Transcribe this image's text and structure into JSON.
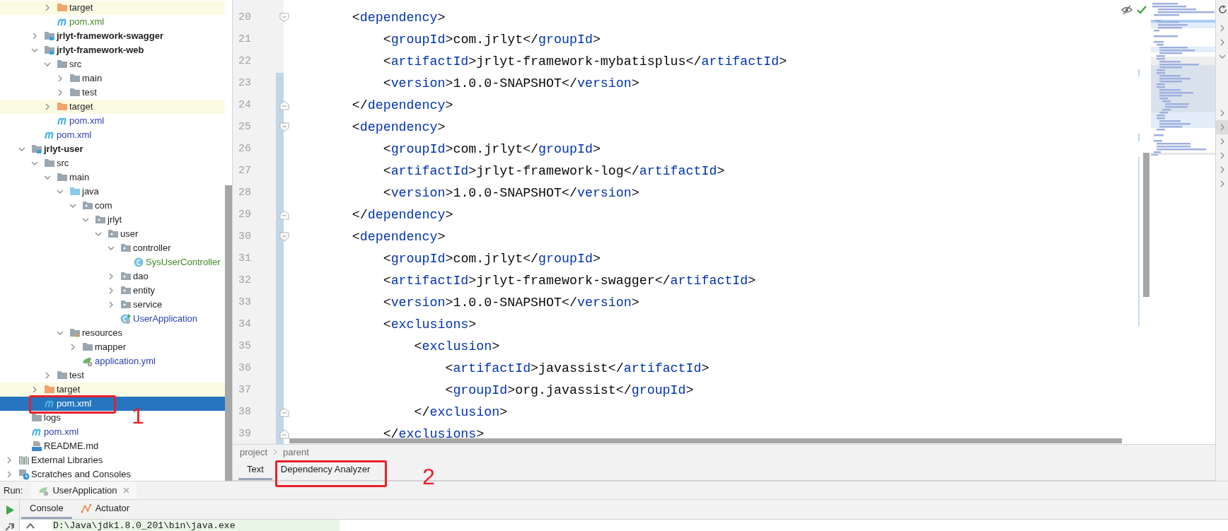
{
  "project_tree": {
    "items": [
      {
        "children": [
          {
            "children": [
              {
                "children": [
                  {
                    "label": "target",
                    "kind": "excluded-folder",
                    "expanded": false,
                    "selected": false
                  },
                  {
                    "label": "pom.xml",
                    "kind": "maven",
                    "color": "#3f8a24",
                    "selected": false
                  }
                ]
              },
              {
                "label": "jrlyt-framework-swagger",
                "kind": "module",
                "expanded": false,
                "selected": false
              },
              {
                "label": "jrlyt-framework-web",
                "kind": "module",
                "expanded": true,
                "selected": false,
                "children": [
                  {
                    "label": "src",
                    "kind": "folder",
                    "expanded": true,
                    "selected": false,
                    "children": [
                      {
                        "label": "main",
                        "kind": "folder",
                        "expanded": false,
                        "selected": false
                      },
                      {
                        "label": "test",
                        "kind": "folder",
                        "expanded": false,
                        "selected": false
                      }
                    ]
                  },
                  {
                    "label": "target",
                    "kind": "excluded-folder",
                    "expanded": false,
                    "selected": false
                  },
                  {
                    "label": "pom.xml",
                    "kind": "maven",
                    "color": "#2a3eb0",
                    "selected": false
                  }
                ]
              },
              {
                "label": "pom.xml",
                "kind": "maven",
                "color": "#2a3eb0",
                "selected": false
              }
            ]
          },
          {
            "label": "jrlyt-user",
            "kind": "module",
            "expanded": true,
            "selected": false,
            "children": [
              {
                "label": "src",
                "kind": "folder",
                "expanded": true,
                "selected": false,
                "children": [
                  {
                    "label": "main",
                    "kind": "folder",
                    "expanded": true,
                    "selected": false,
                    "children": [
                      {
                        "label": "java",
                        "kind": "source-folder",
                        "expanded": true,
                        "selected": false,
                        "children": [
                          {
                            "label": "com",
                            "kind": "package",
                            "expanded": true,
                            "selected": false,
                            "children": [
                              {
                                "label": "jrlyt",
                                "kind": "package",
                                "expanded": true,
                                "selected": false,
                                "children": [
                                  {
                                    "label": "user",
                                    "kind": "package",
                                    "expanded": true,
                                    "selected": false,
                                    "children": [
                                      {
                                        "label": "controller",
                                        "kind": "package",
                                        "expanded": true,
                                        "selected": false,
                                        "children": [
                                          {
                                            "label": "SysUserController",
                                            "kind": "class",
                                            "color": "#3f8a24",
                                            "selected": false
                                          }
                                        ]
                                      },
                                      {
                                        "label": "dao",
                                        "kind": "package",
                                        "expanded": false,
                                        "selected": false
                                      },
                                      {
                                        "label": "entity",
                                        "kind": "package",
                                        "expanded": false,
                                        "selected": false
                                      },
                                      {
                                        "label": "service",
                                        "kind": "package",
                                        "expanded": false,
                                        "selected": false
                                      },
                                      {
                                        "label": "UserApplication",
                                        "kind": "app-class",
                                        "color": "#2a3eb0",
                                        "selected": false
                                      }
                                    ]
                                  }
                                ]
                              }
                            ]
                          }
                        ]
                      },
                      {
                        "label": "resources",
                        "kind": "resources-folder",
                        "expanded": true,
                        "selected": false,
                        "children": [
                          {
                            "label": "mapper",
                            "kind": "folder",
                            "expanded": false,
                            "selected": false
                          },
                          {
                            "label": "application.yml",
                            "kind": "yaml",
                            "color": "#2a3eb0",
                            "selected": false
                          }
                        ]
                      }
                    ]
                  },
                  {
                    "label": "test",
                    "kind": "folder",
                    "expanded": false,
                    "selected": false
                  }
                ]
              },
              {
                "label": "target",
                "kind": "excluded-folder",
                "expanded": false,
                "selected": false
              },
              {
                "label": "pom.xml",
                "kind": "maven",
                "selected": true
              }
            ]
          },
          {
            "label": "logs",
            "kind": "folder",
            "selected": false
          },
          {
            "label": "pom.xml",
            "kind": "maven",
            "color": "#2a3eb0",
            "selected": false
          },
          {
            "label": "README.md",
            "kind": "markdown",
            "selected": false
          }
        ]
      },
      {
        "label": "External Libraries",
        "kind": "libraries",
        "expanded": false,
        "selected": false
      },
      {
        "label": "Scratches and Consoles",
        "kind": "scratches",
        "expanded": false,
        "selected": false
      }
    ]
  },
  "editor": {
    "lines": [
      {
        "number": "20",
        "text": "        <dependency>",
        "changed": false,
        "kind": "fold-start"
      },
      {
        "number": "21",
        "text": "            <groupId>com.jrlyt</groupId>",
        "changed": false,
        "kind": "plain"
      },
      {
        "number": "22",
        "text": "            <artifactId>jrlyt-framework-mybatisplus</artifactId>",
        "changed": false,
        "kind": "plain"
      },
      {
        "number": "23",
        "text": "            <version>1.0.0-SNAPSHOT</version>",
        "changed": true,
        "kind": "plain"
      },
      {
        "number": "24",
        "text": "        </dependency>",
        "changed": true,
        "kind": "fold-end"
      },
      {
        "number": "25",
        "text": "        <dependency>",
        "changed": true,
        "kind": "fold-start"
      },
      {
        "number": "26",
        "text": "            <groupId>com.jrlyt</groupId>",
        "changed": true,
        "kind": "plain"
      },
      {
        "number": "27",
        "text": "            <artifactId>jrlyt-framework-log</artifactId>",
        "changed": true,
        "kind": "plain"
      },
      {
        "number": "28",
        "text": "            <version>1.0.0-SNAPSHOT</version>",
        "changed": true,
        "kind": "plain"
      },
      {
        "number": "29",
        "text": "        </dependency>",
        "changed": true,
        "kind": "fold-end"
      },
      {
        "number": "30",
        "text": "        <dependency>",
        "changed": true,
        "kind": "fold-start"
      },
      {
        "number": "31",
        "text": "            <groupId>com.jrlyt</groupId>",
        "changed": true,
        "kind": "plain"
      },
      {
        "number": "32",
        "text": "            <artifactId>jrlyt-framework-swagger</artifactId>",
        "changed": true,
        "kind": "plain"
      },
      {
        "number": "33",
        "text": "            <version>1.0.0-SNAPSHOT</version>",
        "changed": true,
        "kind": "plain"
      },
      {
        "number": "34",
        "text": "            <exclusions>",
        "changed": true,
        "kind": "plain"
      },
      {
        "number": "35",
        "text": "                <exclusion>",
        "changed": true,
        "kind": "plain"
      },
      {
        "number": "36",
        "text": "                    <artifactId>javassist</artifactId>",
        "changed": true,
        "kind": "plain"
      },
      {
        "number": "37",
        "text": "                    <groupId>org.javassist</groupId>",
        "changed": true,
        "kind": "plain"
      },
      {
        "number": "38",
        "text": "                </exclusion>",
        "changed": true,
        "kind": "fold-end"
      },
      {
        "number": "39",
        "text": "            </exclusions>",
        "changed": true,
        "kind": "fold-end"
      }
    ],
    "breadcrumbs": [
      "project",
      "parent"
    ],
    "tabs": [
      {
        "label": "Text",
        "selected": true
      },
      {
        "label": "Dependency Analyzer",
        "selected": false
      }
    ]
  },
  "run_panel": {
    "title": "Run:",
    "run_tab": "UserApplication",
    "tabs": [
      {
        "label": "Console",
        "kind": "console",
        "selected": true
      },
      {
        "label": "Actuator",
        "kind": "actuator",
        "selected": false
      }
    ],
    "output": "D:\\Java\\jdk1.8.0_201\\bin\\java.exe"
  },
  "annotations": [
    {
      "label": "1"
    },
    {
      "label": "2"
    }
  ]
}
